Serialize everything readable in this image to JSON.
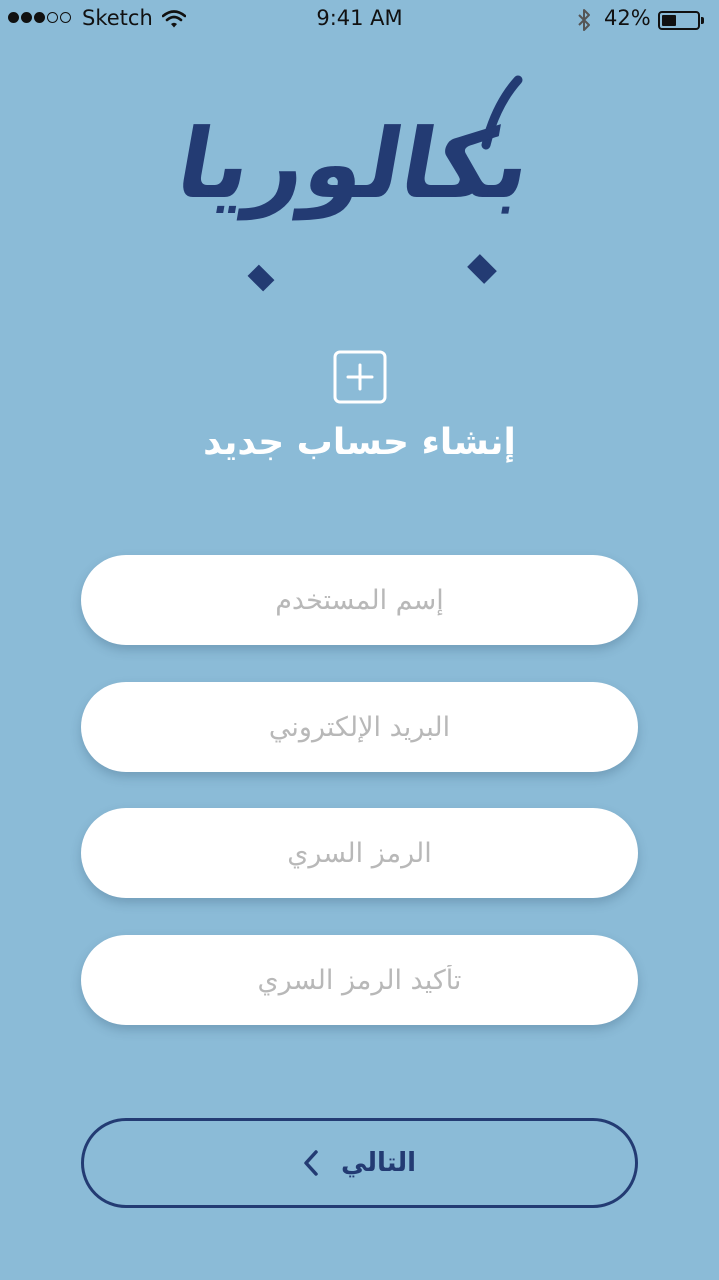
{
  "status_bar": {
    "carrier": "Sketch",
    "time": "9:41 AM",
    "battery_percent": "42%",
    "battery_level": 0.42,
    "signal_bars_filled": 3,
    "signal_bars_total": 5
  },
  "logo": {
    "text": "بكالوريا"
  },
  "header": {
    "title": "إنشاء حساب جديد"
  },
  "form": {
    "username_placeholder": "إسم المستخدم",
    "email_placeholder": "البريد الإلكتروني",
    "password_placeholder": "الرمز السري",
    "confirm_password_placeholder": "تأكيد الرمز السري"
  },
  "next_button": {
    "label": "التالي"
  },
  "colors": {
    "background": "#8bbbd7",
    "brand_navy": "#233b73",
    "field_background": "#ffffff",
    "placeholder_gray": "#b8b8b8"
  },
  "icons": {
    "add": "plus-square-icon",
    "next": "chevron-left-icon",
    "wifi": "wifi-icon",
    "bluetooth": "bluetooth-icon",
    "battery": "battery-icon"
  }
}
